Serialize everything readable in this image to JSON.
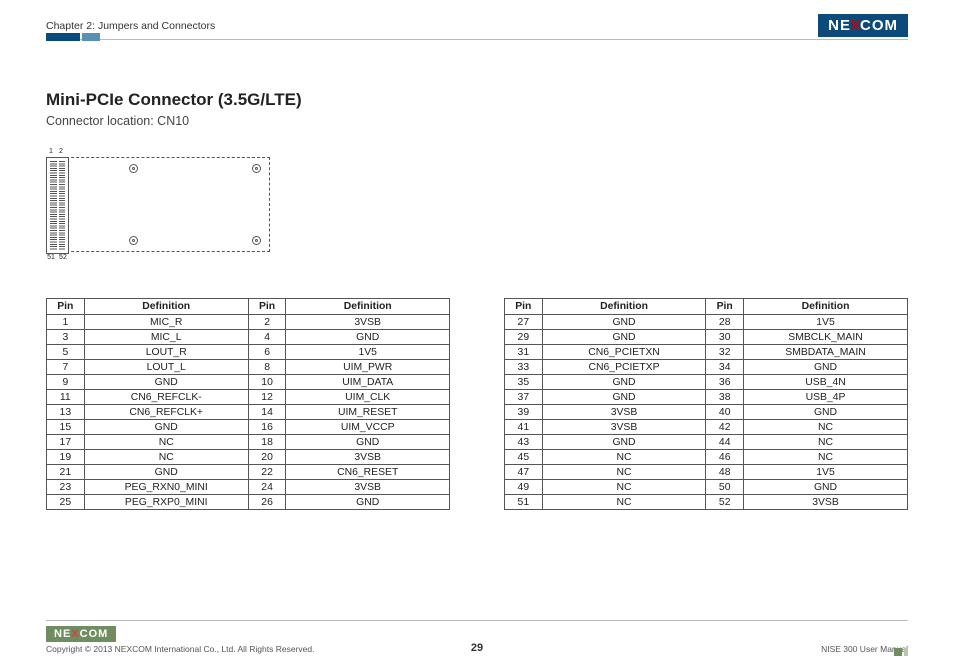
{
  "header": {
    "chapter": "Chapter 2: Jumpers and Connectors",
    "logo_pre": "NE",
    "logo_x": "X",
    "logo_post": "COM"
  },
  "section": {
    "title": "Mini-PCIe Connector (3.5G/LTE)",
    "subtitle": "Connector location: CN10"
  },
  "diagram": {
    "top1": "1",
    "top2": "2",
    "bot1": "51",
    "bot2": "52"
  },
  "table_headers": {
    "pin": "Pin",
    "def": "Definition"
  },
  "table1": [
    [
      "1",
      "MIC_R",
      "2",
      "3VSB"
    ],
    [
      "3",
      "MIC_L",
      "4",
      "GND"
    ],
    [
      "5",
      "LOUT_R",
      "6",
      "1V5"
    ],
    [
      "7",
      "LOUT_L",
      "8",
      "UIM_PWR"
    ],
    [
      "9",
      "GND",
      "10",
      "UIM_DATA"
    ],
    [
      "11",
      "CN6_REFCLK-",
      "12",
      "UIM_CLK"
    ],
    [
      "13",
      "CN6_REFCLK+",
      "14",
      "UIM_RESET"
    ],
    [
      "15",
      "GND",
      "16",
      "UIM_VCCP"
    ],
    [
      "17",
      "NC",
      "18",
      "GND"
    ],
    [
      "19",
      "NC",
      "20",
      "3VSB"
    ],
    [
      "21",
      "GND",
      "22",
      "CN6_RESET"
    ],
    [
      "23",
      "PEG_RXN0_MINI",
      "24",
      "3VSB"
    ],
    [
      "25",
      "PEG_RXP0_MINI",
      "26",
      "GND"
    ]
  ],
  "table2": [
    [
      "27",
      "GND",
      "28",
      "1V5"
    ],
    [
      "29",
      "GND",
      "30",
      "SMBCLK_MAIN"
    ],
    [
      "31",
      "CN6_PCIETXN",
      "32",
      "SMBDATA_MAIN"
    ],
    [
      "33",
      "CN6_PCIETXP",
      "34",
      "GND"
    ],
    [
      "35",
      "GND",
      "36",
      "USB_4N"
    ],
    [
      "37",
      "GND",
      "38",
      "USB_4P"
    ],
    [
      "39",
      "3VSB",
      "40",
      "GND"
    ],
    [
      "41",
      "3VSB",
      "42",
      "NC"
    ],
    [
      "43",
      "GND",
      "44",
      "NC"
    ],
    [
      "45",
      "NC",
      "46",
      "NC"
    ],
    [
      "47",
      "NC",
      "48",
      "1V5"
    ],
    [
      "49",
      "NC",
      "50",
      "GND"
    ],
    [
      "51",
      "NC",
      "52",
      "3VSB"
    ]
  ],
  "footer": {
    "logo_pre": "NE",
    "logo_x": "X",
    "logo_post": "COM",
    "copyright": "Copyright © 2013 NEXCOM International Co., Ltd. All Rights Reserved.",
    "manual": "NISE 300 User Manual",
    "page": "29"
  }
}
